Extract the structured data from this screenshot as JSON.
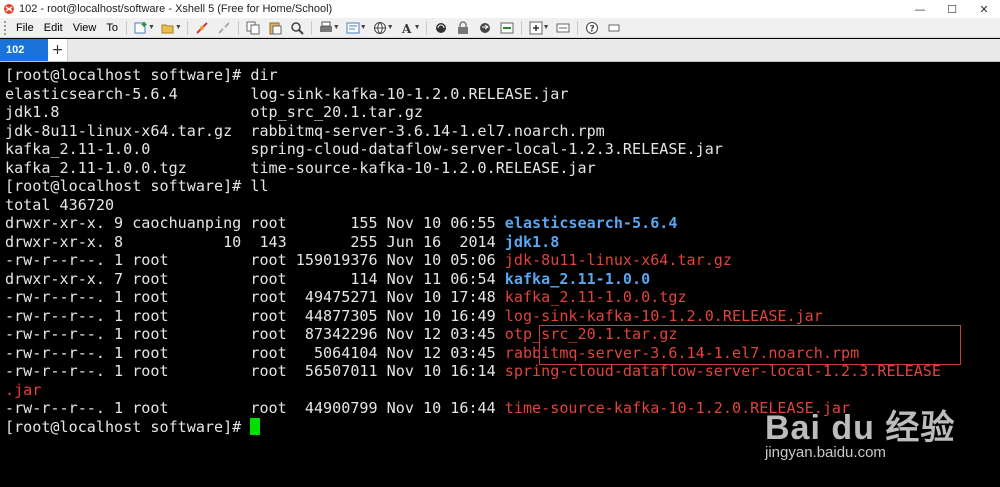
{
  "window": {
    "title": "102 - root@localhost/software - Xshell 5 (Free for Home/School)",
    "minimize": "—",
    "maximize": "☐",
    "close": "✕"
  },
  "menu": {
    "items": [
      "File",
      "Edit",
      "View",
      "To"
    ]
  },
  "toolbar": {
    "icons": [
      "new-session-icon",
      "open-folder-icon",
      "reconnect-icon",
      "disconnect-icon",
      "copy-icon",
      "paste-icon",
      "find-icon",
      "print-icon",
      "properties-icon",
      "globe-icon",
      "font-icon",
      "lock-icon",
      "transfer-icon",
      "xftp-icon",
      "script-icon",
      "add-icon",
      "help-icon"
    ]
  },
  "tabs": {
    "active": "102",
    "add": "+"
  },
  "terminal": {
    "lines": [
      [
        {
          "t": "[root@localhost software]# dir"
        }
      ],
      [
        {
          "t": "elasticsearch-5.6.4        log-sink-kafka-10-1.2.0.RELEASE.jar"
        }
      ],
      [
        {
          "t": "jdk1.8                     otp_src_20.1.tar.gz"
        }
      ],
      [
        {
          "t": "jdk-8u11-linux-x64.tar.gz  rabbitmq-server-3.6.14-1.el7.noarch.rpm"
        }
      ],
      [
        {
          "t": "kafka_2.11-1.0.0           spring-cloud-dataflow-server-local-1.2.3.RELEASE.jar"
        }
      ],
      [
        {
          "t": "kafka_2.11-1.0.0.tgz       time-source-kafka-10-1.2.0.RELEASE.jar"
        }
      ],
      [
        {
          "t": "[root@localhost software]# ll"
        }
      ],
      [
        {
          "t": "total 436720"
        }
      ],
      [
        {
          "t": "drwxr-xr-x. 9 caochuanping root       155 Nov 10 06:55 "
        },
        {
          "t": "elasticsearch-5.6.4",
          "c": "blue"
        }
      ],
      [
        {
          "t": "drwxr-xr-x. 8           10  143       255 Jun 16  2014 "
        },
        {
          "t": "jdk1.8",
          "c": "blue"
        }
      ],
      [
        {
          "t": "-rw-r--r--. 1 root         root 159019376 Nov 10 05:06 "
        },
        {
          "t": "jdk-8u11-linux-x64.tar.gz",
          "c": "red"
        }
      ],
      [
        {
          "t": "drwxr-xr-x. 7 root         root       114 Nov 11 06:54 "
        },
        {
          "t": "kafka_2.11-1.0.0",
          "c": "blue"
        }
      ],
      [
        {
          "t": "-rw-r--r--. 1 root         root  49475271 Nov 10 17:48 "
        },
        {
          "t": "kafka_2.11-1.0.0.tgz",
          "c": "red"
        }
      ],
      [
        {
          "t": "-rw-r--r--. 1 root         root  44877305 Nov 10 16:49 "
        },
        {
          "t": "log-sink-kafka-10-1.2.0.RELEASE.jar",
          "c": "red"
        }
      ],
      [
        {
          "t": "-rw-r--r--. 1 root         root  87342296 Nov 12 03:45 "
        },
        {
          "t": "otp_src_20.1.tar.gz",
          "c": "red"
        }
      ],
      [
        {
          "t": "-rw-r--r--. 1 root         root   5064104 Nov 12 03:45 "
        },
        {
          "t": "rabbitmq-server-3.6.14-1.el7.noarch.rpm",
          "c": "red"
        }
      ],
      [
        {
          "t": "-rw-r--r--. 1 root         root  56507011 Nov 10 16:14 "
        },
        {
          "t": "spring-cloud-dataflow-server-local-1.2.3.RELEASE",
          "c": "red"
        }
      ],
      [
        {
          "t": ".jar",
          "c": "red"
        }
      ],
      [
        {
          "t": "-rw-r--r--. 1 root         root  44900799 Nov 10 16:44 "
        },
        {
          "t": "time-source-kafka-10-1.2.0.RELEASE.jar",
          "c": "red"
        }
      ],
      [
        {
          "t": "[root@localhost software]# "
        },
        {
          "cursor": true
        }
      ]
    ]
  },
  "watermark": {
    "logo": "Bai du 经验",
    "url": "jingyan.baidu.com"
  },
  "colors": {
    "directory": "#5aa6f0",
    "archive": "#e0443a",
    "cursor": "#00e000",
    "tab_active": "#1a73d9"
  }
}
